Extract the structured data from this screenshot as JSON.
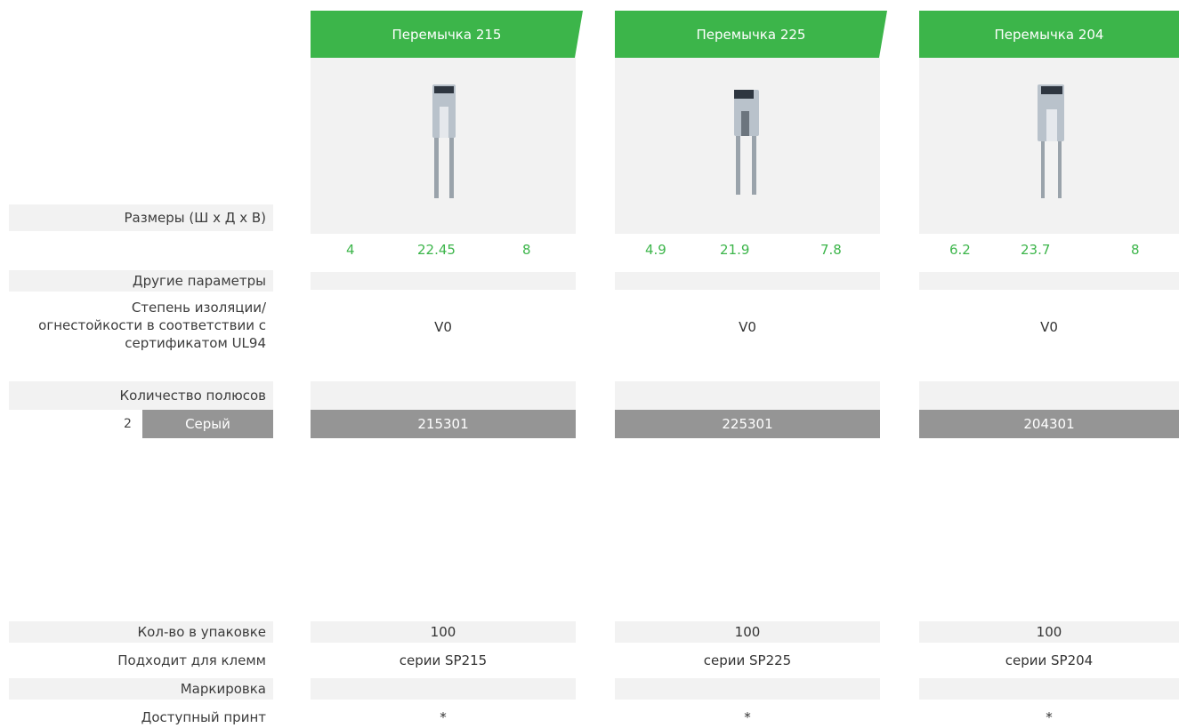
{
  "colors": {
    "accent": "#3cb54a",
    "shade": "#f2f2f2",
    "gray_bar": "#959595"
  },
  "labels": {
    "dimensions": "Размеры (Ш х Д х В)",
    "other_params": "Другие параметры",
    "insulation_line1": "Степень изоляции/",
    "insulation_line2": "огнестойкости в соответствии с",
    "insulation_line3": "сертификатом UL94",
    "poles": "Количество полюсов",
    "pole_count": "2",
    "color_name": "Серый",
    "pack_qty": "Кол-во в упаковке",
    "fits": "Подходит для клемм",
    "marking": "Маркировка",
    "print": "Доступный принт"
  },
  "products": [
    {
      "title": "Перемычка 215",
      "image": "jumper-image",
      "w": "4",
      "l": "22.45",
      "h": "8",
      "insulation": "V0",
      "article": "215301",
      "pack": "100",
      "series": "серии SP215",
      "print": "*"
    },
    {
      "title": "Перемычка 225",
      "image": "jumper-image",
      "w": "4.9",
      "l": "21.9",
      "h": "7.8",
      "insulation": "V0",
      "article": "225301",
      "pack": "100",
      "series": "серии SP225",
      "print": "*"
    },
    {
      "title": "Перемычка 204",
      "image": "jumper-image",
      "w": "6.2",
      "l": "23.7",
      "h": "8",
      "insulation": "V0",
      "article": "204301",
      "pack": "100",
      "series": "серии SP204",
      "print": "*"
    }
  ]
}
